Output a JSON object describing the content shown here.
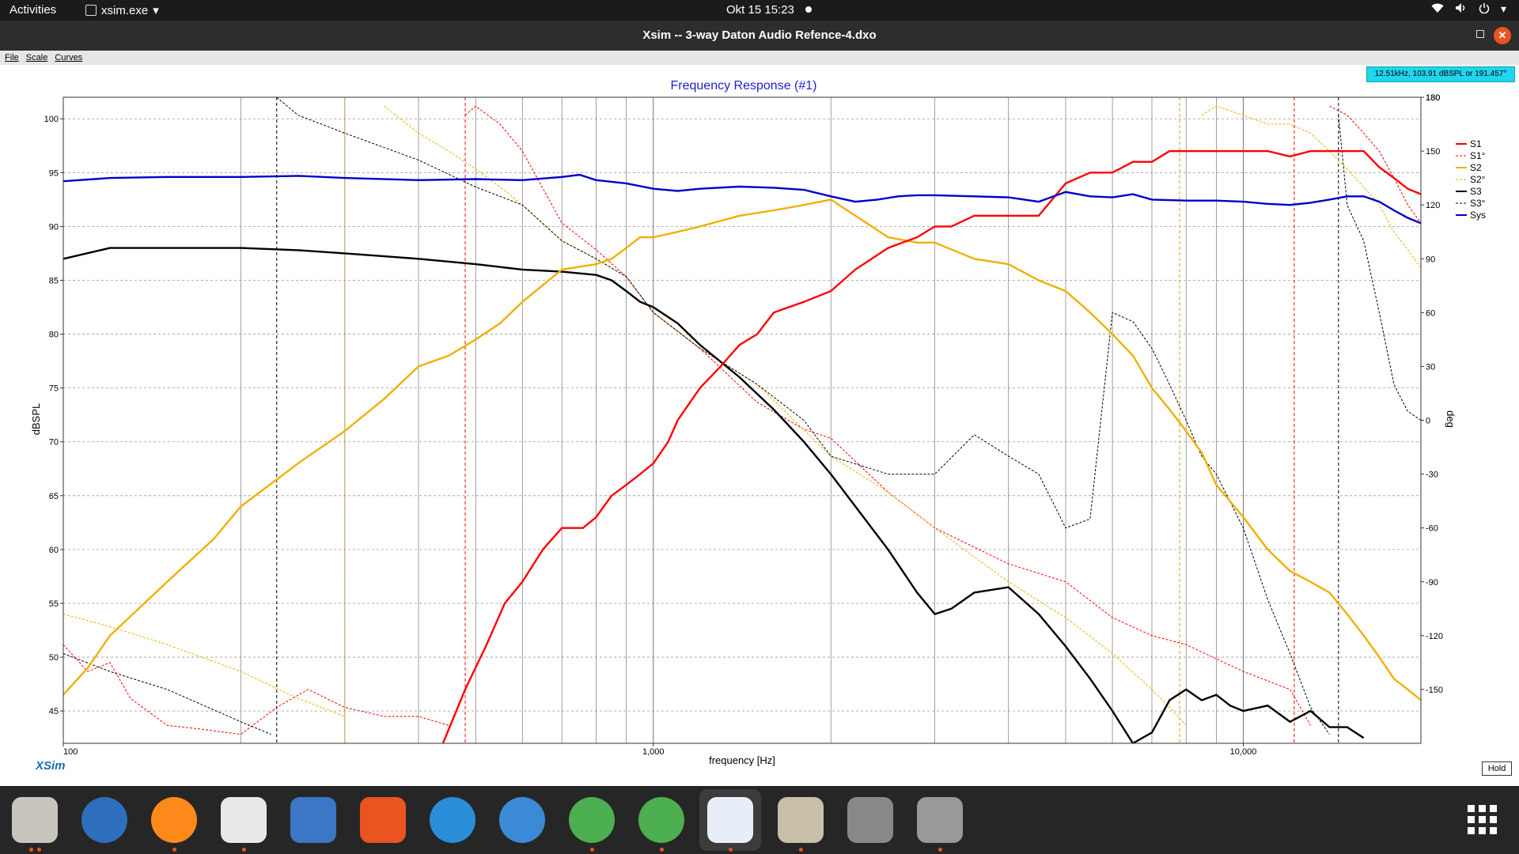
{
  "topbar": {
    "activities": "Activities",
    "app_name": "xsim.exe",
    "clock": "Okt 15  15:23"
  },
  "window": {
    "title": "Xsim -- 3-way Daton Audio Refence-4.dxo"
  },
  "menu": [
    "File",
    "Scale",
    "Curves"
  ],
  "readout": "12.51kHz, 103.91 dBSPL or 191.457°",
  "chart_data": {
    "type": "line",
    "title": "Frequency Response (#1)",
    "xlabel": "frequency [Hz]",
    "ylabel": "dBSPL",
    "y2label": "deg",
    "xscale": "log",
    "xlim": [
      100,
      20000
    ],
    "ylim": [
      42,
      102
    ],
    "y2lim": [
      -180,
      180
    ],
    "grid": true,
    "legend_position": "right",
    "x_ticks": [
      "100",
      "1,000",
      "10,000"
    ],
    "y_ticks": [
      45,
      50,
      55,
      60,
      65,
      70,
      75,
      80,
      85,
      90,
      95,
      100
    ],
    "y2_ticks": [
      -150,
      -120,
      -90,
      -60,
      -30,
      0,
      30,
      60,
      90,
      120,
      150,
      180
    ],
    "series": [
      {
        "name": "S1",
        "axis": "left",
        "color": "#ff0000",
        "style": "solid",
        "x": [
          440,
          480,
          520,
          560,
          600,
          650,
          700,
          760,
          800,
          850,
          900,
          950,
          1000,
          1060,
          1100,
          1200,
          1300,
          1400,
          1500,
          1600,
          1800,
          2000,
          2200,
          2500,
          2800,
          3000,
          3200,
          3500,
          4000,
          4500,
          5000,
          5500,
          6000,
          6500,
          7000,
          7500,
          8000,
          8500,
          9000,
          10000,
          11000,
          12000,
          13000,
          14000,
          15000,
          16000,
          17000,
          18000,
          19000,
          20000
        ],
        "y": [
          42,
          47,
          51,
          55,
          57,
          60,
          62,
          62,
          63,
          65,
          66,
          67,
          68,
          70,
          72,
          75,
          77,
          79,
          80,
          82,
          83,
          84,
          86,
          88,
          89,
          90,
          90,
          91,
          91,
          91,
          94,
          95,
          95,
          96,
          96,
          97,
          97,
          97,
          97,
          97,
          97,
          96.5,
          97,
          97,
          97,
          97,
          95.5,
          94.5,
          93.5,
          93
        ]
      },
      {
        "name": "S1°",
        "axis": "right",
        "color": "#ff0000",
        "style": "dashed",
        "x": [
          100,
          110,
          120,
          130,
          150,
          170,
          200,
          230,
          260,
          300,
          350,
          400,
          450,
          480,
          500,
          550,
          600,
          700,
          800,
          900,
          1000,
          1200,
          1500,
          1800,
          2000,
          2500,
          3000,
          4000,
          5000,
          6000,
          7000,
          8000,
          10000,
          12000,
          13000,
          14000,
          15000,
          16000,
          17000,
          18000,
          19000,
          20000
        ],
        "y": [
          -125,
          -140,
          -135,
          -155,
          -170,
          -172,
          -175,
          -160,
          -150,
          -160,
          -165,
          -165,
          -170,
          170,
          175,
          165,
          150,
          110,
          95,
          80,
          60,
          40,
          10,
          -5,
          -10,
          -40,
          -60,
          -80,
          -90,
          -110,
          -120,
          -125,
          -140,
          -150,
          -170,
          175,
          170,
          160,
          150,
          135,
          120,
          110
        ]
      },
      {
        "name": "S2",
        "axis": "left",
        "color": "#f0b000",
        "style": "solid",
        "x": [
          100,
          110,
          120,
          150,
          180,
          200,
          250,
          300,
          350,
          400,
          450,
          500,
          550,
          600,
          700,
          800,
          850,
          900,
          950,
          1000,
          1100,
          1200,
          1400,
          1600,
          1800,
          2000,
          2200,
          2500,
          2800,
          3000,
          3500,
          4000,
          4500,
          5000,
          5500,
          6000,
          6500,
          7000,
          7500,
          8000,
          8500,
          9000,
          10000,
          11000,
          12000,
          13000,
          14000,
          15000,
          16000,
          17000,
          18000,
          19000,
          20000
        ],
        "y": [
          46.5,
          49,
          52,
          57,
          61,
          64,
          68,
          71,
          74,
          77,
          78,
          79.5,
          81,
          83,
          86,
          86.5,
          87,
          88,
          89,
          89,
          89.5,
          90,
          91,
          91.5,
          92,
          92.5,
          91,
          89,
          88.5,
          88.5,
          87,
          86.5,
          85,
          84,
          82,
          80,
          78,
          75,
          73,
          71,
          69,
          66,
          63,
          60,
          58,
          57,
          56,
          54,
          52,
          50,
          48,
          47,
          46
        ]
      },
      {
        "name": "S2°",
        "axis": "right",
        "color": "#f0b000",
        "style": "dashed",
        "x": [
          100,
          120,
          150,
          200,
          250,
          300,
          350,
          400,
          450,
          500,
          550,
          600,
          700,
          800,
          900,
          1000,
          1200,
          1500,
          2000,
          2500,
          3000,
          4000,
          5000,
          6000,
          7000,
          7500,
          8000,
          8500,
          9000,
          10000,
          11000,
          12000,
          13000,
          14000,
          15000,
          16000,
          17000,
          18000,
          19000,
          20000
        ],
        "y": [
          -108,
          -115,
          -125,
          -140,
          -155,
          -165,
          175,
          160,
          150,
          140,
          130,
          120,
          100,
          90,
          80,
          60,
          40,
          20,
          -20,
          -40,
          -60,
          -90,
          -110,
          -130,
          -150,
          -160,
          -170,
          170,
          175,
          170,
          165,
          165,
          160,
          150,
          140,
          130,
          120,
          105,
          95,
          85
        ]
      },
      {
        "name": "S3",
        "axis": "left",
        "color": "#000000",
        "style": "solid",
        "x": [
          100,
          120,
          150,
          200,
          250,
          300,
          400,
          500,
          600,
          700,
          800,
          850,
          900,
          950,
          1000,
          1100,
          1200,
          1400,
          1600,
          1800,
          2000,
          2200,
          2500,
          2800,
          3000,
          3200,
          3500,
          4000,
          4500,
          5000,
          5500,
          6000,
          6500,
          7000,
          7500,
          8000,
          8500,
          9000,
          9500,
          10000,
          11000,
          12000,
          13000,
          14000,
          15000,
          16000
        ],
        "y": [
          87,
          88,
          88,
          88,
          87.8,
          87.5,
          87,
          86.5,
          86,
          85.8,
          85.5,
          85,
          84,
          83,
          82.5,
          81,
          79,
          76,
          73,
          70,
          67,
          64,
          60,
          56,
          54,
          54.5,
          56,
          56.5,
          54,
          51,
          48,
          45,
          42,
          43,
          46,
          47,
          46,
          46.5,
          45.5,
          45,
          45.5,
          44,
          45,
          43.5,
          43.5,
          42.5
        ]
      },
      {
        "name": "S3°",
        "axis": "right",
        "color": "#000000",
        "style": "dashed",
        "x": [
          100,
          120,
          150,
          200,
          225,
          230,
          250,
          300,
          400,
          500,
          600,
          700,
          800,
          900,
          1000,
          1200,
          1500,
          1800,
          2000,
          2500,
          3000,
          3500,
          4000,
          4500,
          5000,
          5500,
          6000,
          6500,
          7000,
          7500,
          8000,
          8500,
          9000,
          10000,
          11000,
          12000,
          13000,
          14000,
          14500,
          15000,
          16000,
          17000,
          18000,
          19000,
          20000
        ],
        "y": [
          -130,
          -140,
          -150,
          -168,
          -175,
          180,
          170,
          160,
          145,
          130,
          120,
          100,
          90,
          80,
          60,
          40,
          20,
          0,
          -20,
          -30,
          -30,
          -8,
          -20,
          -30,
          -60,
          -55,
          60,
          55,
          40,
          20,
          0,
          -20,
          -30,
          -60,
          -100,
          -130,
          -160,
          -175,
          170,
          120,
          100,
          60,
          20,
          5,
          0
        ]
      },
      {
        "name": "Sys",
        "axis": "left",
        "color": "#0000cc",
        "style": "solid",
        "x": [
          100,
          120,
          150,
          200,
          250,
          300,
          400,
          500,
          600,
          700,
          750,
          800,
          900,
          1000,
          1100,
          1200,
          1400,
          1600,
          1800,
          2000,
          2200,
          2400,
          2600,
          2800,
          3000,
          3500,
          4000,
          4500,
          5000,
          5500,
          6000,
          6500,
          7000,
          8000,
          9000,
          10000,
          11000,
          12000,
          13000,
          14000,
          15000,
          16000,
          17000,
          18000,
          19000,
          20000
        ],
        "y": [
          94.2,
          94.5,
          94.6,
          94.6,
          94.7,
          94.5,
          94.3,
          94.4,
          94.3,
          94.6,
          94.8,
          94.3,
          94.0,
          93.5,
          93.3,
          93.5,
          93.7,
          93.6,
          93.4,
          92.8,
          92.3,
          92.5,
          92.8,
          92.9,
          92.9,
          92.8,
          92.7,
          92.3,
          93.2,
          92.8,
          92.7,
          93.0,
          92.5,
          92.4,
          92.4,
          92.3,
          92.1,
          92.0,
          92.2,
          92.5,
          92.8,
          92.8,
          92.3,
          91.5,
          90.8,
          90.3
        ]
      }
    ]
  },
  "brand": "XSim",
  "hold_button": "Hold"
}
